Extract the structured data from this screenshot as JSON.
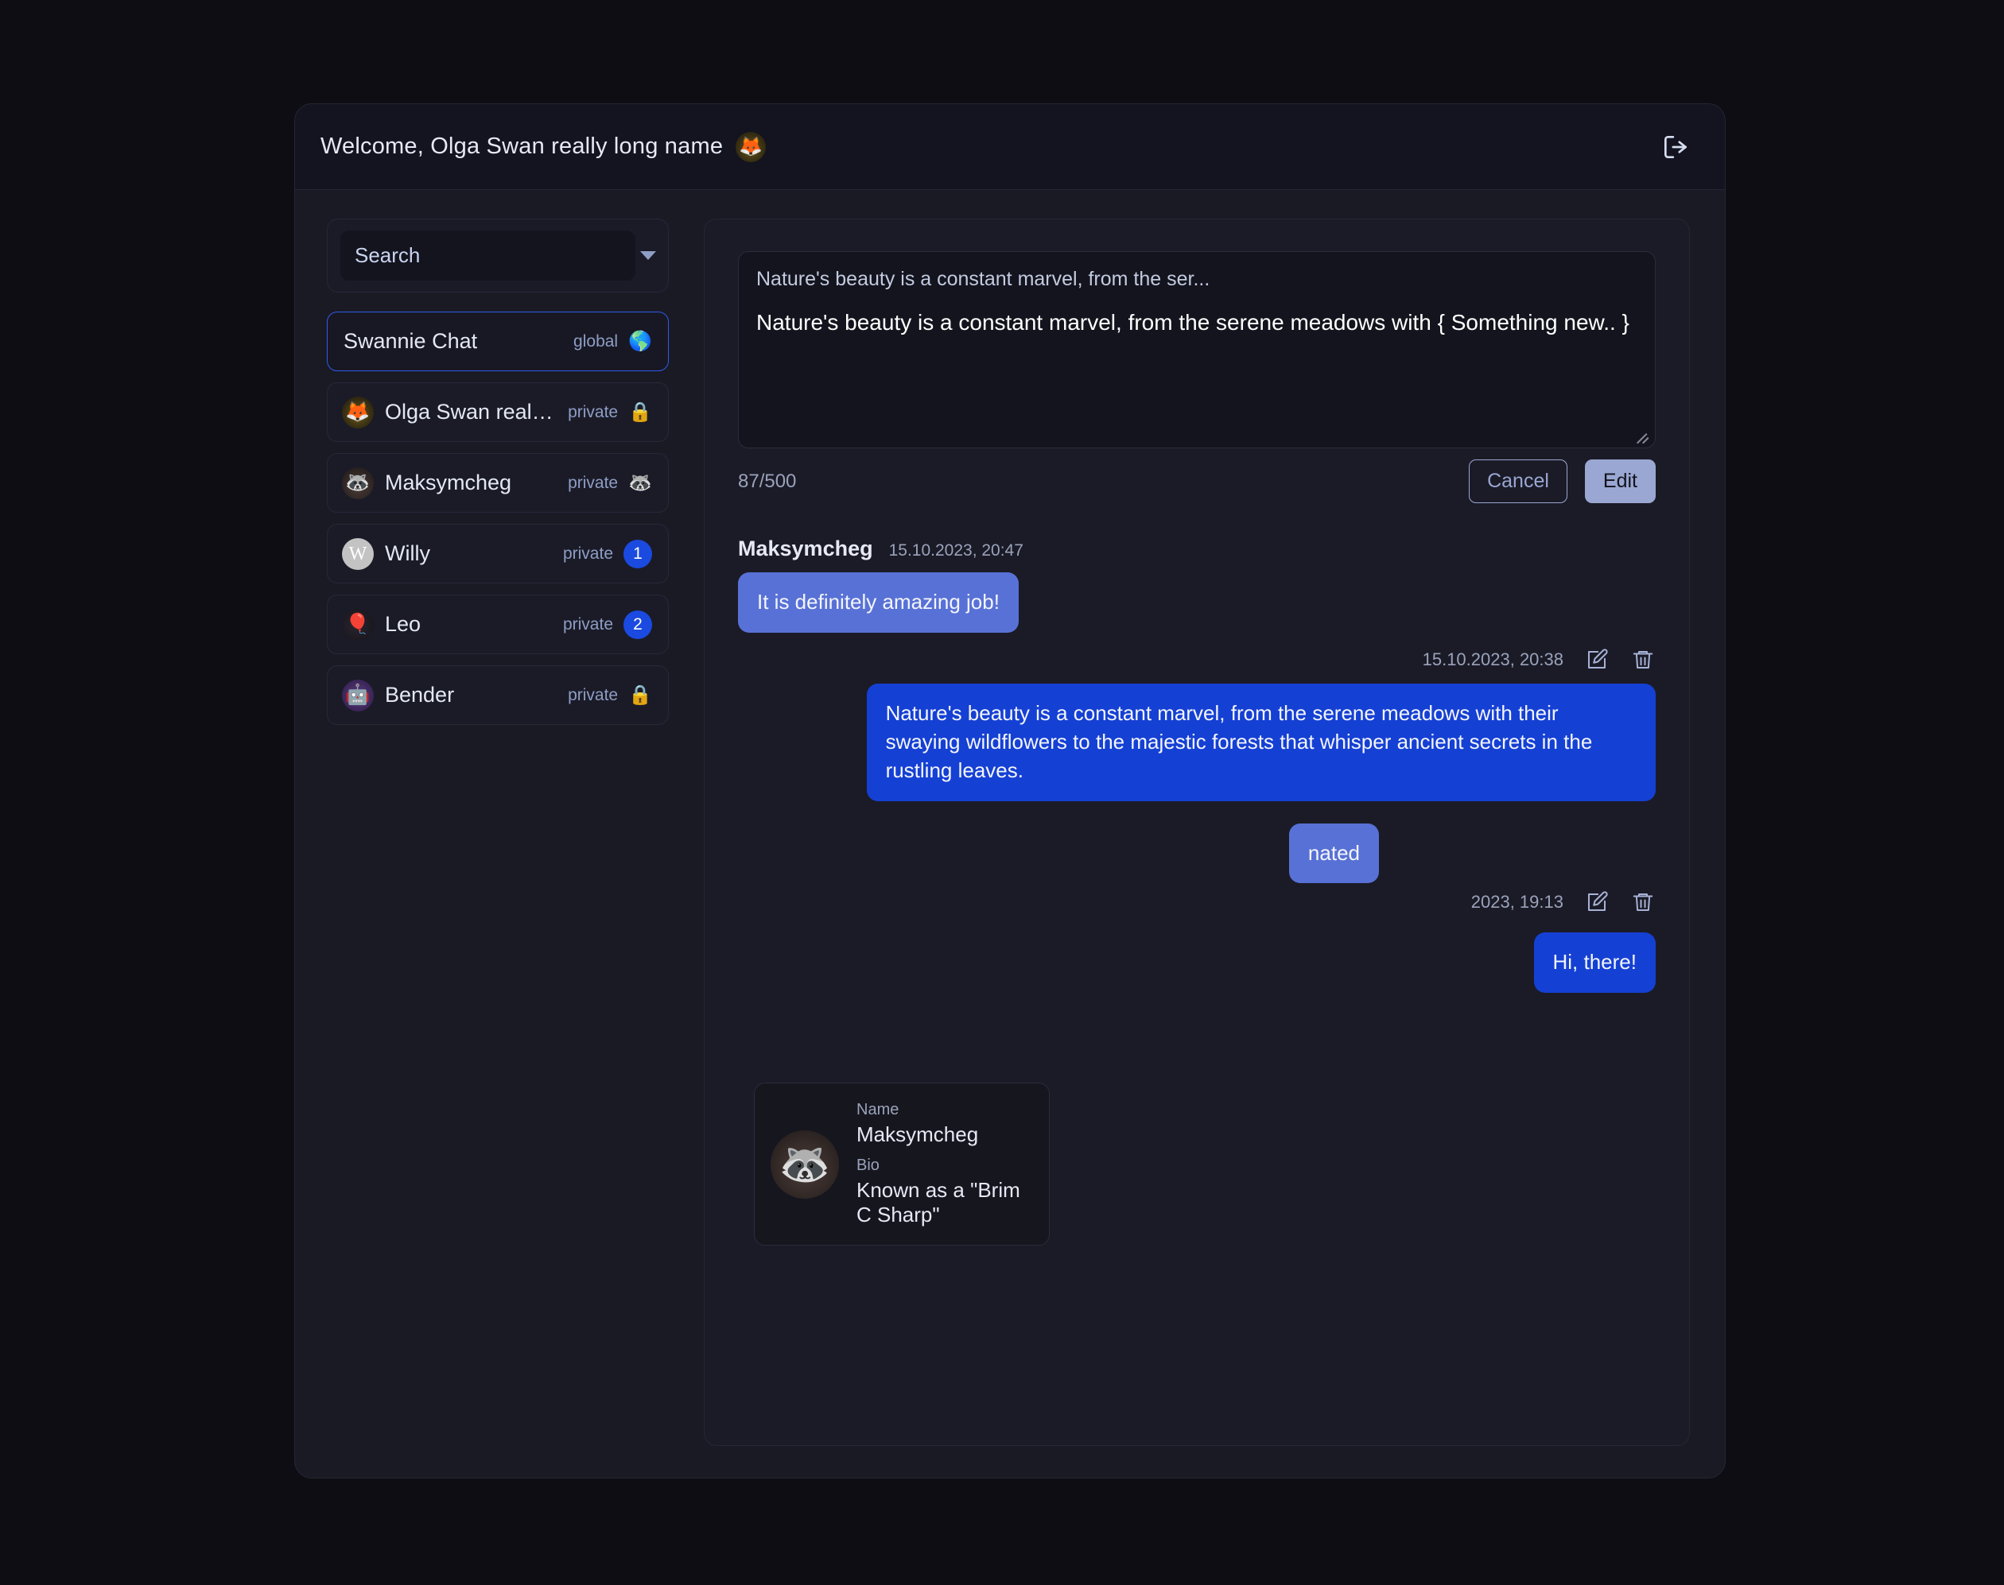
{
  "header": {
    "welcome_text": "Welcome, Olga Swan really long name",
    "avatar_emoji": "🦊",
    "logout_icon": "logout-icon"
  },
  "sidebar": {
    "search": {
      "placeholder": "Search",
      "value": "",
      "dropdown_icon": "chevron-down-icon"
    },
    "chats": [
      {
        "name": "Swannie Chat",
        "type": "global",
        "icon": "globe-icon",
        "icon_glyph": "🌎",
        "avatar": "",
        "avatar_class": "",
        "selected": true,
        "badge": ""
      },
      {
        "name": "Olga Swan really long...",
        "type": "private",
        "icon": "lock-icon",
        "icon_glyph": "🔒",
        "avatar": "🦊",
        "avatar_class": "av-olga",
        "selected": false,
        "badge": ""
      },
      {
        "name": "Maksymcheg",
        "type": "private",
        "icon": "lock-icon",
        "icon_glyph": "🦝",
        "avatar": "🦝",
        "avatar_class": "av-maks",
        "selected": false,
        "badge": ""
      },
      {
        "name": "Willy",
        "type": "private",
        "icon": "badge",
        "icon_glyph": "",
        "avatar": "W",
        "avatar_class": "av-willy",
        "selected": false,
        "badge": "1"
      },
      {
        "name": "Leo",
        "type": "private",
        "icon": "badge",
        "icon_glyph": "",
        "avatar": "🎈",
        "avatar_class": "av-leo",
        "selected": false,
        "badge": "2"
      },
      {
        "name": "Bender",
        "type": "private",
        "icon": "lock-icon",
        "icon_glyph": "🔒",
        "avatar": "🤖",
        "avatar_class": "av-bend",
        "selected": false,
        "badge": ""
      }
    ]
  },
  "chat_panel": {
    "edit": {
      "preview_text": "Nature's beauty is a constant marvel, from the ser...",
      "textarea_value": "Nature's beauty is a constant marvel, from the serene meadows with { Something new.. }",
      "counter": "87/500",
      "cancel_label": "Cancel",
      "submit_label": "Edit"
    },
    "messages": [
      {
        "author": "Maksymcheg",
        "time": "15.10.2023, 20:47",
        "text": "It is definitely amazing job!",
        "side": "in"
      },
      {
        "author": "",
        "time": "15.10.2023, 20:38",
        "text": "Nature's beauty is a constant marvel, from the serene meadows with their swaying wildflowers to the majestic forests that whisper ancient secrets in the rustling leaves.",
        "side": "out"
      },
      {
        "author": "",
        "time": "2023, 19:13",
        "text": "nated",
        "side": "in-partial"
      },
      {
        "author": "",
        "time": "",
        "text": "Hi, there!",
        "side": "out"
      }
    ],
    "edit_icon": "edit-pencil-icon",
    "delete_icon": "trash-icon"
  },
  "profile_card": {
    "avatar_emoji": "🦝",
    "name_label": "Name",
    "name_value": "Maksymcheg",
    "bio_label": "Bio",
    "bio_value": "Known as a \"Brim C Sharp\""
  },
  "colors": {
    "page_bg": "#0d0d13",
    "card_bg": "#1a1a24",
    "accent_blue": "#1540d4",
    "bubble_in": "#5871d6",
    "selected_border": "#2d5bec",
    "lavender": "#9aa7d2"
  }
}
